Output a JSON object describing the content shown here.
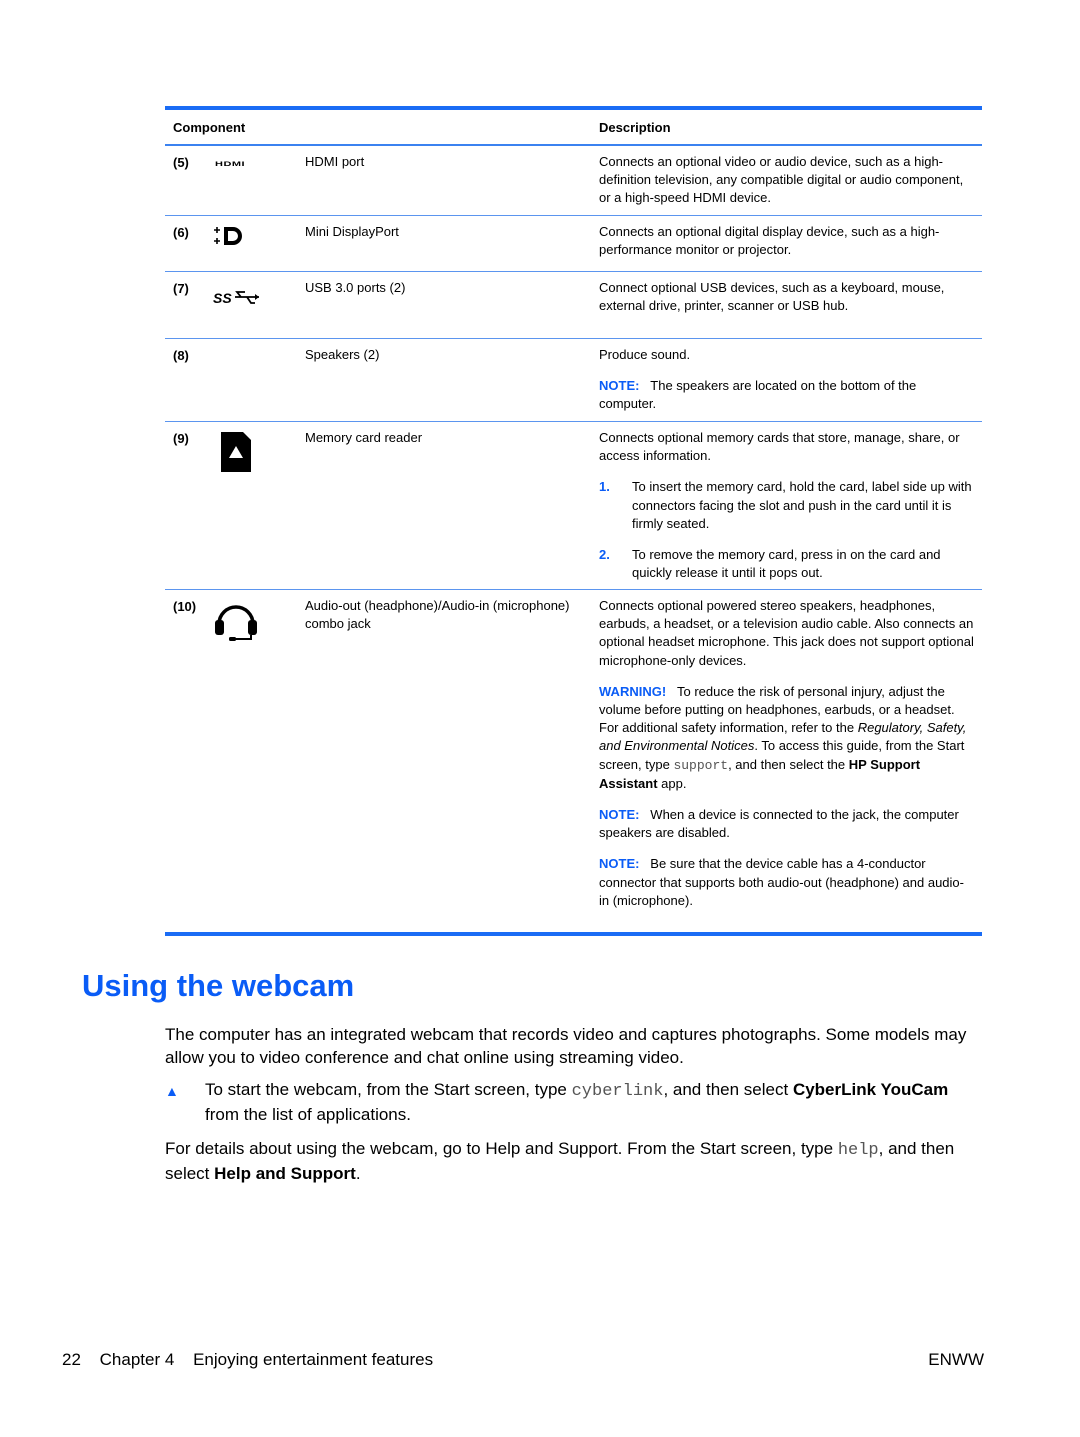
{
  "table": {
    "headers": {
      "component": "Component",
      "description": "Description"
    },
    "rows": [
      {
        "num": "(5)",
        "icon": "hdmi-icon",
        "icon_text": "HDMI",
        "name": "HDMI port",
        "description": "Connects an optional video or audio device, such as a high-definition television, any compatible digital or audio component, or a high-speed HDMI device."
      },
      {
        "num": "(6)",
        "icon": "mini-displayport-icon",
        "name": "Mini DisplayPort",
        "description": "Connects an optional digital display device, such as a high-performance monitor or projector."
      },
      {
        "num": "(7)",
        "icon": "usb-3-superspeed-icon",
        "name": "USB 3.0 ports (2)",
        "description": "Connect optional USB devices, such as a keyboard, mouse, external drive, printer, scanner or USB hub."
      },
      {
        "num": "(8)",
        "icon": "",
        "name": "Speakers (2)",
        "description": "Produce sound.",
        "note_label": "NOTE:",
        "note_text": "The speakers are located on the bottom of the computer."
      },
      {
        "num": "(9)",
        "icon": "memory-card-icon",
        "name": "Memory card reader",
        "description": "Connects optional memory cards that store, manage, share, or access information.",
        "steps": [
          {
            "n": "1.",
            "text": "To insert the memory card, hold the card, label side up with connectors facing the slot and push in the card until it is firmly seated."
          },
          {
            "n": "2.",
            "text": "To remove the memory card, press in on the card and quickly release it until it pops out."
          }
        ]
      },
      {
        "num": "(10)",
        "icon": "headset-icon",
        "name": "Audio-out (headphone)/Audio-in (microphone) combo jack",
        "description": "Connects optional powered stereo speakers, headphones, earbuds, a headset, or a television audio cable. Also connects an optional headset microphone. This jack does not support optional microphone-only devices.",
        "warning": {
          "label": "WARNING!",
          "text1": "To reduce the risk of personal injury, adjust the volume before putting on headphones, earbuds, or a headset. For additional safety information, refer to the",
          "italic": "Regulatory, Safety, and Environmental Notices",
          "text2": ". To access this guide, from the Start screen, type",
          "code": "support",
          "text3": ", and then select the",
          "bold": "HP Support Assistant",
          "text4": "app."
        },
        "notes": [
          {
            "label": "NOTE:",
            "text": "When a device is connected to the jack, the computer speakers are disabled."
          },
          {
            "label": "NOTE:",
            "text": "Be sure that the device cable has a 4-conductor connector that supports both audio-out (headphone) and audio-in (microphone)."
          }
        ]
      }
    ]
  },
  "section": {
    "title": "Using the webcam",
    "intro": "The computer has an integrated webcam that records video and captures photographs. Some models may allow you to video conference and chat online using streaming video.",
    "bullet": {
      "icon": "triangle-bullet-icon",
      "text1": "To start the webcam, from the Start screen, type",
      "code": "cyberlink",
      "text2": ", and then select",
      "bold": "CyberLink YouCam",
      "text3": "from the list of applications."
    },
    "details": {
      "text1": "For details about using the webcam, go to Help and Support. From the Start screen, type",
      "code": "help",
      "text2": ", and then select",
      "bold": "Help and Support",
      "text3": "."
    }
  },
  "footer": {
    "page_number": "22",
    "chapter": "Chapter 4",
    "chapter_title": "Enjoying entertainment features",
    "locale": "ENWW"
  },
  "colors": {
    "accent": "#0a5cf6",
    "rule": "#1a6cf5"
  }
}
